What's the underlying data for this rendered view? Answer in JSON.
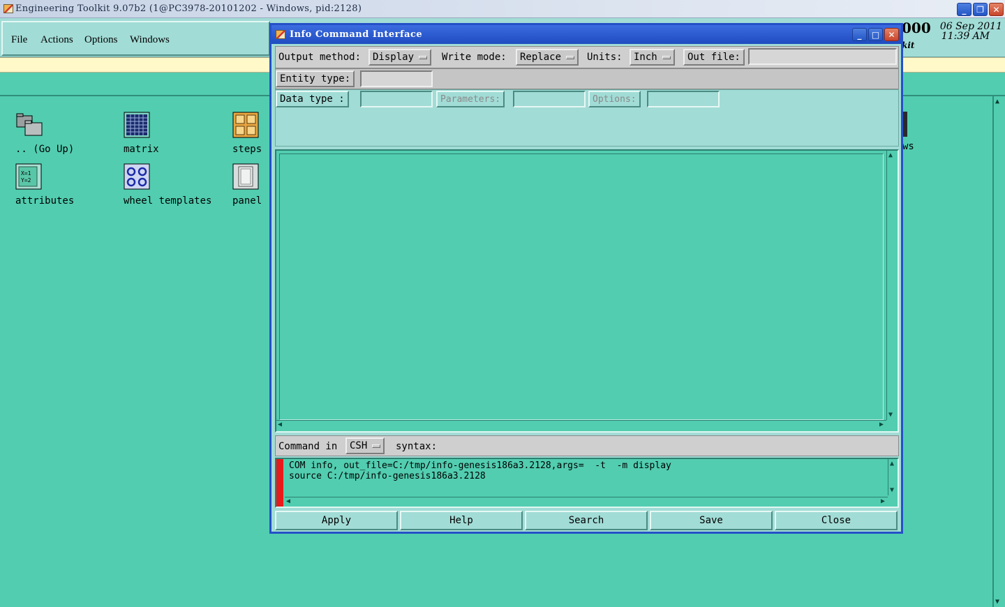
{
  "main_window": {
    "title": "Engineering Toolkit 9.07b2 (1@PC3978-20101202 - Windows, pid:2128)",
    "controls": [
      "_",
      "❐",
      "✕"
    ]
  },
  "menu": {
    "file": "File",
    "actions": "Actions",
    "options": "Options",
    "windows": "Windows"
  },
  "clock": {
    "partial": "000",
    "partial_sub": "kit",
    "date": "06 Sep 2011",
    "time": "11:39 AM"
  },
  "desktop_icons": [
    {
      "label": ".. (Go Up)"
    },
    {
      "label": "matrix"
    },
    {
      "label": "steps"
    },
    {
      "label": "attributes"
    },
    {
      "label": "wheel templates"
    },
    {
      "label": "panel"
    }
  ],
  "desktop_partial_label": "ws",
  "dialog": {
    "title": "Info Command Interface",
    "controls": [
      "_",
      "□",
      "✕"
    ],
    "output_method_label": "Output method:",
    "output_method_value": "Display",
    "write_mode_label": "Write mode:",
    "write_mode_value": "Replace",
    "units_label": "Units:",
    "units_value": "Inch",
    "out_file_label": "Out file:",
    "out_file_value": "",
    "entity_type_label": "Entity type:",
    "entity_type_value": "",
    "data_type_label": "Data type   :",
    "data_type_value": "",
    "parameters_label": "Parameters:",
    "parameters_value": "",
    "options_label": "Options:",
    "options_value": "",
    "command_in_label": "Command in",
    "shell_value": "CSH",
    "syntax_label": "syntax:",
    "command_lines": [
      "COM info, out_file=C:/tmp/info-genesis186a3.2128,args=  -t  -m display",
      "source C:/tmp/info-genesis186a3.2128"
    ],
    "buttons": {
      "apply": "Apply",
      "help": "Help",
      "search": "Search",
      "save": "Save",
      "close": "Close"
    }
  },
  "colors": {
    "desktop": "#52cdb0",
    "panel": "#a2dcd6",
    "dialog_title": "#2450c8",
    "message_strip": "#fff8c8",
    "command_marker": "#e81a1a"
  }
}
